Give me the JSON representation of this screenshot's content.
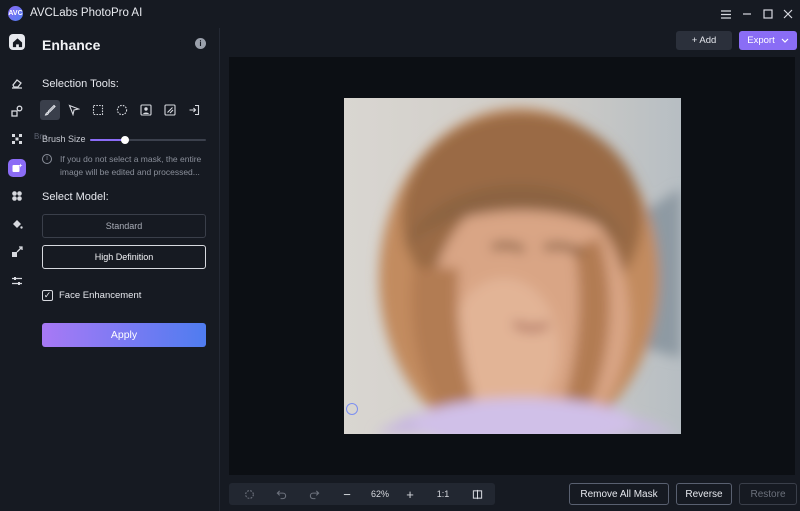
{
  "app": {
    "logo_text": "AVC",
    "title": "AVCLabs PhotoPro AI"
  },
  "window_controls": [
    "menu-icon",
    "minimize-icon",
    "maximize-icon",
    "close-icon"
  ],
  "rail": [
    "home-icon",
    "eraser-icon",
    "replace-icon",
    "mosaic-icon",
    "enhance-icon",
    "fan-icon",
    "fill-icon",
    "resize-icon",
    "sliders-icon"
  ],
  "panel": {
    "title": "Enhance",
    "selection_tools_label": "Selection Tools:",
    "tools": [
      "brush-icon",
      "pointer-icon",
      "rectangle-icon",
      "ellipse-icon",
      "portrait-icon",
      "auto-select-icon",
      "import-icon"
    ],
    "brush_ghost": "Bru",
    "brush_size_label": "Brush Size",
    "brush_size_value": 0.3,
    "hint_icon": "i",
    "hint": "If you do not select a mask, the entire image will be edited and processed...",
    "select_model_label": "Select Model:",
    "models": [
      "Standard",
      "High Definition"
    ],
    "selected_model": "High Definition",
    "face_enhancement_label": "Face Enhancement",
    "face_enhancement_checked": true,
    "apply_label": "Apply"
  },
  "toolbar": {
    "add_label": "+ Add",
    "export_label": "Export"
  },
  "bottom": {
    "zoom_out": "−",
    "zoom_level": "62%",
    "zoom_in": "+",
    "ratio": "1:1",
    "remove_all_mask": "Remove All Mask",
    "reverse": "Reverse",
    "restore": "Restore"
  },
  "colors": {
    "accent": "#8b6cf6",
    "background": "#161a22",
    "canvas": "#0c0f14"
  }
}
